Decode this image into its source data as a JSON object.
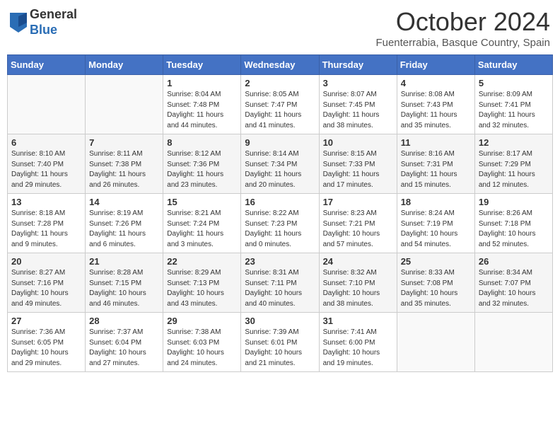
{
  "header": {
    "logo_general": "General",
    "logo_blue": "Blue",
    "month_title": "October 2024",
    "subtitle": "Fuenterrabia, Basque Country, Spain"
  },
  "days_of_week": [
    "Sunday",
    "Monday",
    "Tuesday",
    "Wednesday",
    "Thursday",
    "Friday",
    "Saturday"
  ],
  "weeks": [
    [
      {
        "day": "",
        "info": ""
      },
      {
        "day": "",
        "info": ""
      },
      {
        "day": "1",
        "info": "Sunrise: 8:04 AM\nSunset: 7:48 PM\nDaylight: 11 hours and 44 minutes."
      },
      {
        "day": "2",
        "info": "Sunrise: 8:05 AM\nSunset: 7:47 PM\nDaylight: 11 hours and 41 minutes."
      },
      {
        "day": "3",
        "info": "Sunrise: 8:07 AM\nSunset: 7:45 PM\nDaylight: 11 hours and 38 minutes."
      },
      {
        "day": "4",
        "info": "Sunrise: 8:08 AM\nSunset: 7:43 PM\nDaylight: 11 hours and 35 minutes."
      },
      {
        "day": "5",
        "info": "Sunrise: 8:09 AM\nSunset: 7:41 PM\nDaylight: 11 hours and 32 minutes."
      }
    ],
    [
      {
        "day": "6",
        "info": "Sunrise: 8:10 AM\nSunset: 7:40 PM\nDaylight: 11 hours and 29 minutes."
      },
      {
        "day": "7",
        "info": "Sunrise: 8:11 AM\nSunset: 7:38 PM\nDaylight: 11 hours and 26 minutes."
      },
      {
        "day": "8",
        "info": "Sunrise: 8:12 AM\nSunset: 7:36 PM\nDaylight: 11 hours and 23 minutes."
      },
      {
        "day": "9",
        "info": "Sunrise: 8:14 AM\nSunset: 7:34 PM\nDaylight: 11 hours and 20 minutes."
      },
      {
        "day": "10",
        "info": "Sunrise: 8:15 AM\nSunset: 7:33 PM\nDaylight: 11 hours and 17 minutes."
      },
      {
        "day": "11",
        "info": "Sunrise: 8:16 AM\nSunset: 7:31 PM\nDaylight: 11 hours and 15 minutes."
      },
      {
        "day": "12",
        "info": "Sunrise: 8:17 AM\nSunset: 7:29 PM\nDaylight: 11 hours and 12 minutes."
      }
    ],
    [
      {
        "day": "13",
        "info": "Sunrise: 8:18 AM\nSunset: 7:28 PM\nDaylight: 11 hours and 9 minutes."
      },
      {
        "day": "14",
        "info": "Sunrise: 8:19 AM\nSunset: 7:26 PM\nDaylight: 11 hours and 6 minutes."
      },
      {
        "day": "15",
        "info": "Sunrise: 8:21 AM\nSunset: 7:24 PM\nDaylight: 11 hours and 3 minutes."
      },
      {
        "day": "16",
        "info": "Sunrise: 8:22 AM\nSunset: 7:23 PM\nDaylight: 11 hours and 0 minutes."
      },
      {
        "day": "17",
        "info": "Sunrise: 8:23 AM\nSunset: 7:21 PM\nDaylight: 10 hours and 57 minutes."
      },
      {
        "day": "18",
        "info": "Sunrise: 8:24 AM\nSunset: 7:19 PM\nDaylight: 10 hours and 54 minutes."
      },
      {
        "day": "19",
        "info": "Sunrise: 8:26 AM\nSunset: 7:18 PM\nDaylight: 10 hours and 52 minutes."
      }
    ],
    [
      {
        "day": "20",
        "info": "Sunrise: 8:27 AM\nSunset: 7:16 PM\nDaylight: 10 hours and 49 minutes."
      },
      {
        "day": "21",
        "info": "Sunrise: 8:28 AM\nSunset: 7:15 PM\nDaylight: 10 hours and 46 minutes."
      },
      {
        "day": "22",
        "info": "Sunrise: 8:29 AM\nSunset: 7:13 PM\nDaylight: 10 hours and 43 minutes."
      },
      {
        "day": "23",
        "info": "Sunrise: 8:31 AM\nSunset: 7:11 PM\nDaylight: 10 hours and 40 minutes."
      },
      {
        "day": "24",
        "info": "Sunrise: 8:32 AM\nSunset: 7:10 PM\nDaylight: 10 hours and 38 minutes."
      },
      {
        "day": "25",
        "info": "Sunrise: 8:33 AM\nSunset: 7:08 PM\nDaylight: 10 hours and 35 minutes."
      },
      {
        "day": "26",
        "info": "Sunrise: 8:34 AM\nSunset: 7:07 PM\nDaylight: 10 hours and 32 minutes."
      }
    ],
    [
      {
        "day": "27",
        "info": "Sunrise: 7:36 AM\nSunset: 6:05 PM\nDaylight: 10 hours and 29 minutes."
      },
      {
        "day": "28",
        "info": "Sunrise: 7:37 AM\nSunset: 6:04 PM\nDaylight: 10 hours and 27 minutes."
      },
      {
        "day": "29",
        "info": "Sunrise: 7:38 AM\nSunset: 6:03 PM\nDaylight: 10 hours and 24 minutes."
      },
      {
        "day": "30",
        "info": "Sunrise: 7:39 AM\nSunset: 6:01 PM\nDaylight: 10 hours and 21 minutes."
      },
      {
        "day": "31",
        "info": "Sunrise: 7:41 AM\nSunset: 6:00 PM\nDaylight: 10 hours and 19 minutes."
      },
      {
        "day": "",
        "info": ""
      },
      {
        "day": "",
        "info": ""
      }
    ]
  ]
}
